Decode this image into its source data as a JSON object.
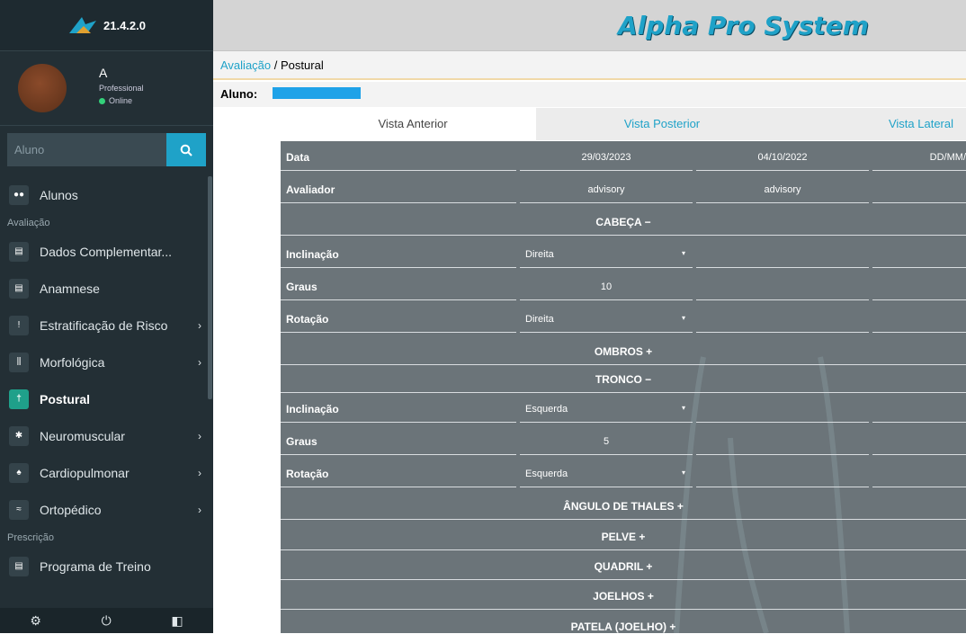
{
  "app": {
    "version": "21.4.2.0",
    "brand": "Alpha Pro System"
  },
  "user": {
    "name": "A",
    "role": "Professional",
    "status": "Online"
  },
  "search": {
    "placeholder": "Aluno"
  },
  "menu": {
    "alunos": "Alunos",
    "sec_avaliacao": "Avaliação",
    "dados": "Dados Complementar...",
    "anamnese": "Anamnese",
    "estratificacao": "Estratificação de Risco",
    "morfologica": "Morfológica",
    "postural": "Postural",
    "neuromuscular": "Neuromuscular",
    "cardio": "Cardiopulmonar",
    "ortopedico": "Ortopédico",
    "sec_prescricao": "Prescrição",
    "programa": "Programa de Treino"
  },
  "breadcrumb": {
    "parent": "Avaliação",
    "sep": "/",
    "current": "Postural"
  },
  "aluno": {
    "label": "Aluno:"
  },
  "tabs": {
    "anterior": "Vista Anterior",
    "posterior": "Vista Posterior",
    "lateral": "Vista Lateral"
  },
  "table": {
    "data_label": "Data",
    "date1": "29/03/2023",
    "date2": "04/10/2022",
    "date3": "DD/MM/",
    "avaliador_label": "Avaliador",
    "avaliador1": "advisory",
    "avaliador2": "advisory",
    "cabeca": "CABEÇA −",
    "inclinacao": "Inclinação",
    "graus": "Graus",
    "rotacao": "Rotação",
    "cab_incl": "Direita",
    "cab_graus": "10",
    "cab_rot": "Direita",
    "ombros": "OMBROS +",
    "tronco": "TRONCO −",
    "tr_incl": "Esquerda",
    "tr_graus": "5",
    "tr_rot": "Esquerda",
    "thales": "ÂNGULO DE THALES +",
    "pelve": "PELVE +",
    "quadril": "QUADRIL +",
    "joelhos": "JOELHOS +",
    "patela": "PATELA (JOELHO) +"
  }
}
